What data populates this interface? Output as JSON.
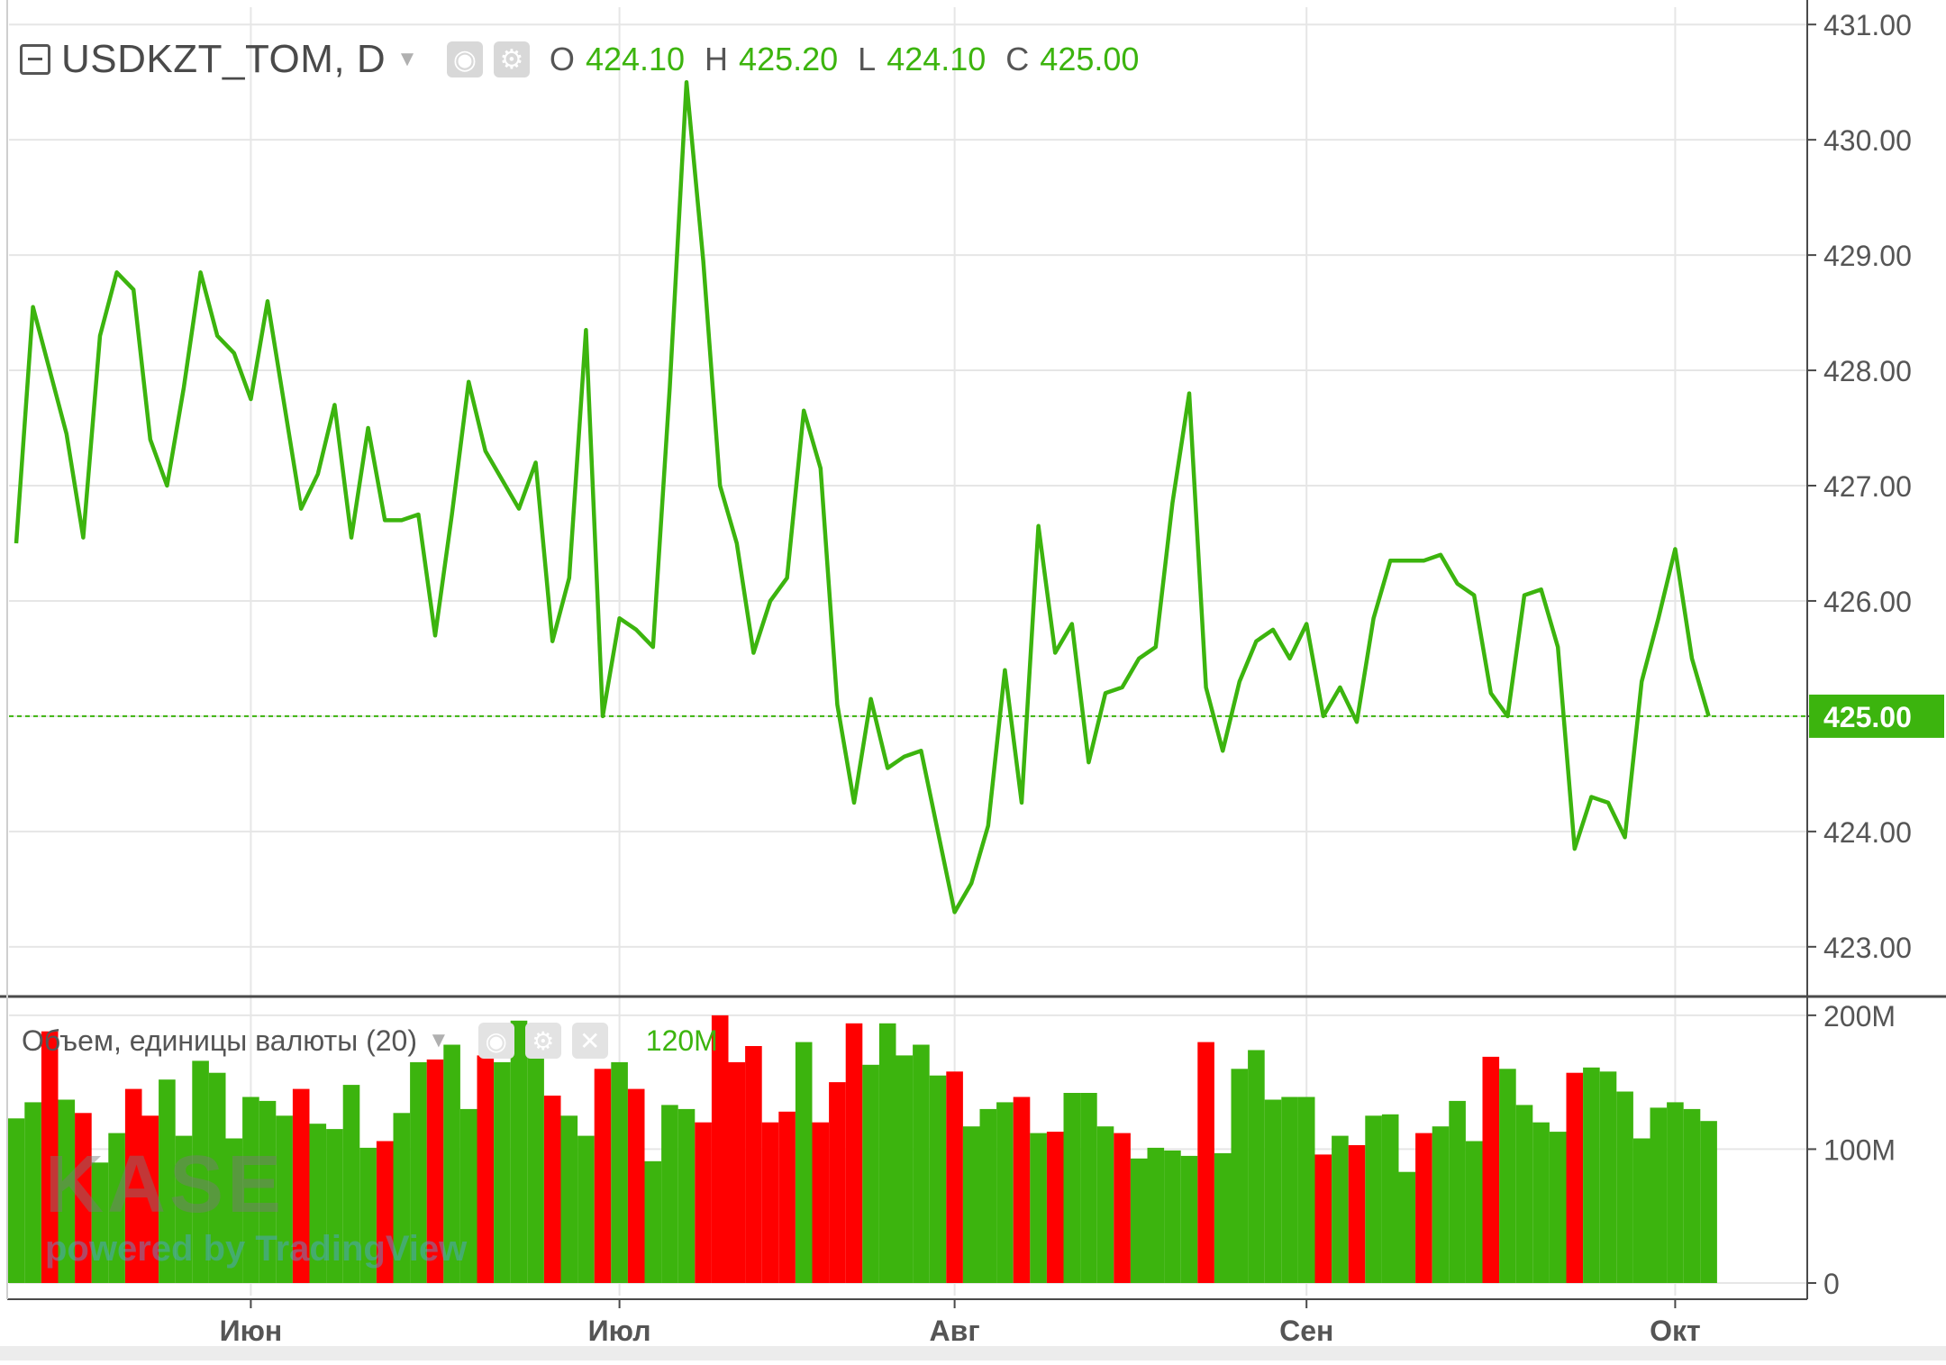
{
  "header": {
    "symbol": "USDKZT_TOM, D",
    "ohlc": [
      {
        "label": "O",
        "value": "424.10"
      },
      {
        "label": "H",
        "value": "425.20"
      },
      {
        "label": "L",
        "value": "424.10"
      },
      {
        "label": "C",
        "value": "425.00"
      }
    ]
  },
  "volume_legend": {
    "title": "Объем, единицы валюты (20)",
    "value": "120M"
  },
  "watermark": {
    "logo": "KASE",
    "powered": "powered by TradingView"
  },
  "colors": {
    "up": "#3cb40e",
    "down": "#ff0000",
    "grid": "#e6e6e6",
    "axis_text": "#555555",
    "last_price_bg": "#3cb40e"
  },
  "chart_data": [
    {
      "type": "line",
      "name": "USDKZT_TOM, D",
      "x_ticks": [
        "Июн",
        "Июл",
        "Авг",
        "Сен",
        "Окт"
      ],
      "x_tick_index": [
        14,
        36,
        56,
        77,
        99
      ],
      "y_ticks": [
        "423.00",
        "424.00",
        "425.00",
        "426.00",
        "427.00",
        "428.00",
        "429.00",
        "430.00",
        "431.00"
      ],
      "ylim": [
        422.6,
        431.15
      ],
      "last_price": "425.00",
      "values": [
        426.5,
        428.55,
        428.0,
        427.45,
        426.55,
        428.3,
        428.85,
        428.7,
        427.4,
        427.0,
        427.85,
        428.85,
        428.3,
        428.15,
        427.75,
        428.6,
        427.7,
        426.8,
        427.1,
        427.7,
        426.55,
        427.5,
        426.7,
        426.7,
        426.75,
        425.7,
        426.75,
        427.9,
        427.3,
        427.05,
        426.8,
        427.2,
        425.65,
        426.2,
        428.35,
        425.0,
        425.85,
        425.75,
        425.6,
        427.85,
        430.5,
        428.95,
        427.0,
        426.5,
        425.55,
        426.0,
        426.2,
        427.65,
        427.15,
        425.1,
        424.25,
        425.15,
        424.55,
        424.65,
        424.7,
        424.0,
        423.3,
        423.55,
        424.05,
        425.4,
        424.25,
        426.65,
        425.55,
        425.8,
        424.6,
        425.2,
        425.25,
        425.5,
        425.6,
        426.85,
        427.8,
        425.25,
        424.7,
        425.3,
        425.65,
        425.75,
        425.5,
        425.8,
        425.0,
        425.25,
        424.95,
        425.85,
        426.35,
        426.35,
        426.35,
        426.4,
        426.15,
        426.05,
        425.2,
        425.0,
        426.05,
        426.1,
        425.6,
        423.85,
        424.3,
        424.25,
        423.95,
        425.3,
        425.85,
        426.45,
        425.5,
        425.0
      ]
    },
    {
      "type": "bar",
      "name": "Объем, единицы валюты (20)",
      "y_ticks": [
        "0",
        "100M",
        "200M"
      ],
      "ylim": [
        0,
        210
      ],
      "values": [
        123,
        135,
        188,
        137,
        127,
        90,
        112,
        145,
        125,
        152,
        110,
        166,
        157,
        108,
        139,
        136,
        125,
        145,
        119,
        115,
        148,
        101,
        106,
        127,
        165,
        167,
        178,
        130,
        170,
        165,
        196,
        180,
        140,
        125,
        110,
        160,
        165,
        145,
        91,
        133,
        130,
        120,
        200,
        165,
        177,
        120,
        128,
        180,
        120,
        150,
        194,
        163,
        194,
        170,
        178,
        155,
        158,
        117,
        130,
        135,
        139,
        112,
        113,
        142,
        142,
        117,
        112,
        93,
        101,
        99,
        95,
        180,
        97,
        160,
        174,
        137,
        139,
        139,
        96,
        110,
        103,
        125,
        126,
        83,
        112,
        117,
        136,
        106,
        169,
        160,
        133,
        120,
        113,
        157,
        161,
        158,
        143,
        108,
        131,
        135,
        130,
        121
      ],
      "directions": [
        "u",
        "u",
        "d",
        "u",
        "d",
        "u",
        "u",
        "d",
        "d",
        "u",
        "u",
        "u",
        "u",
        "u",
        "u",
        "u",
        "u",
        "d",
        "u",
        "u",
        "u",
        "u",
        "d",
        "u",
        "u",
        "d",
        "u",
        "u",
        "d",
        "u",
        "u",
        "u",
        "d",
        "u",
        "u",
        "d",
        "u",
        "d",
        "u",
        "u",
        "u",
        "d",
        "d",
        "d",
        "d",
        "d",
        "d",
        "u",
        "d",
        "d",
        "d",
        "u",
        "u",
        "u",
        "u",
        "u",
        "d",
        "u",
        "u",
        "u",
        "d",
        "u",
        "d",
        "u",
        "u",
        "u",
        "d",
        "u",
        "u",
        "u",
        "u",
        "d",
        "u",
        "u",
        "u",
        "u",
        "u",
        "u",
        "d",
        "u",
        "d",
        "u",
        "u",
        "u",
        "d",
        "u",
        "u",
        "u",
        "d",
        "u",
        "u",
        "u",
        "u",
        "d",
        "u",
        "u",
        "u",
        "u",
        "u",
        "u",
        "u",
        "u"
      ]
    }
  ]
}
